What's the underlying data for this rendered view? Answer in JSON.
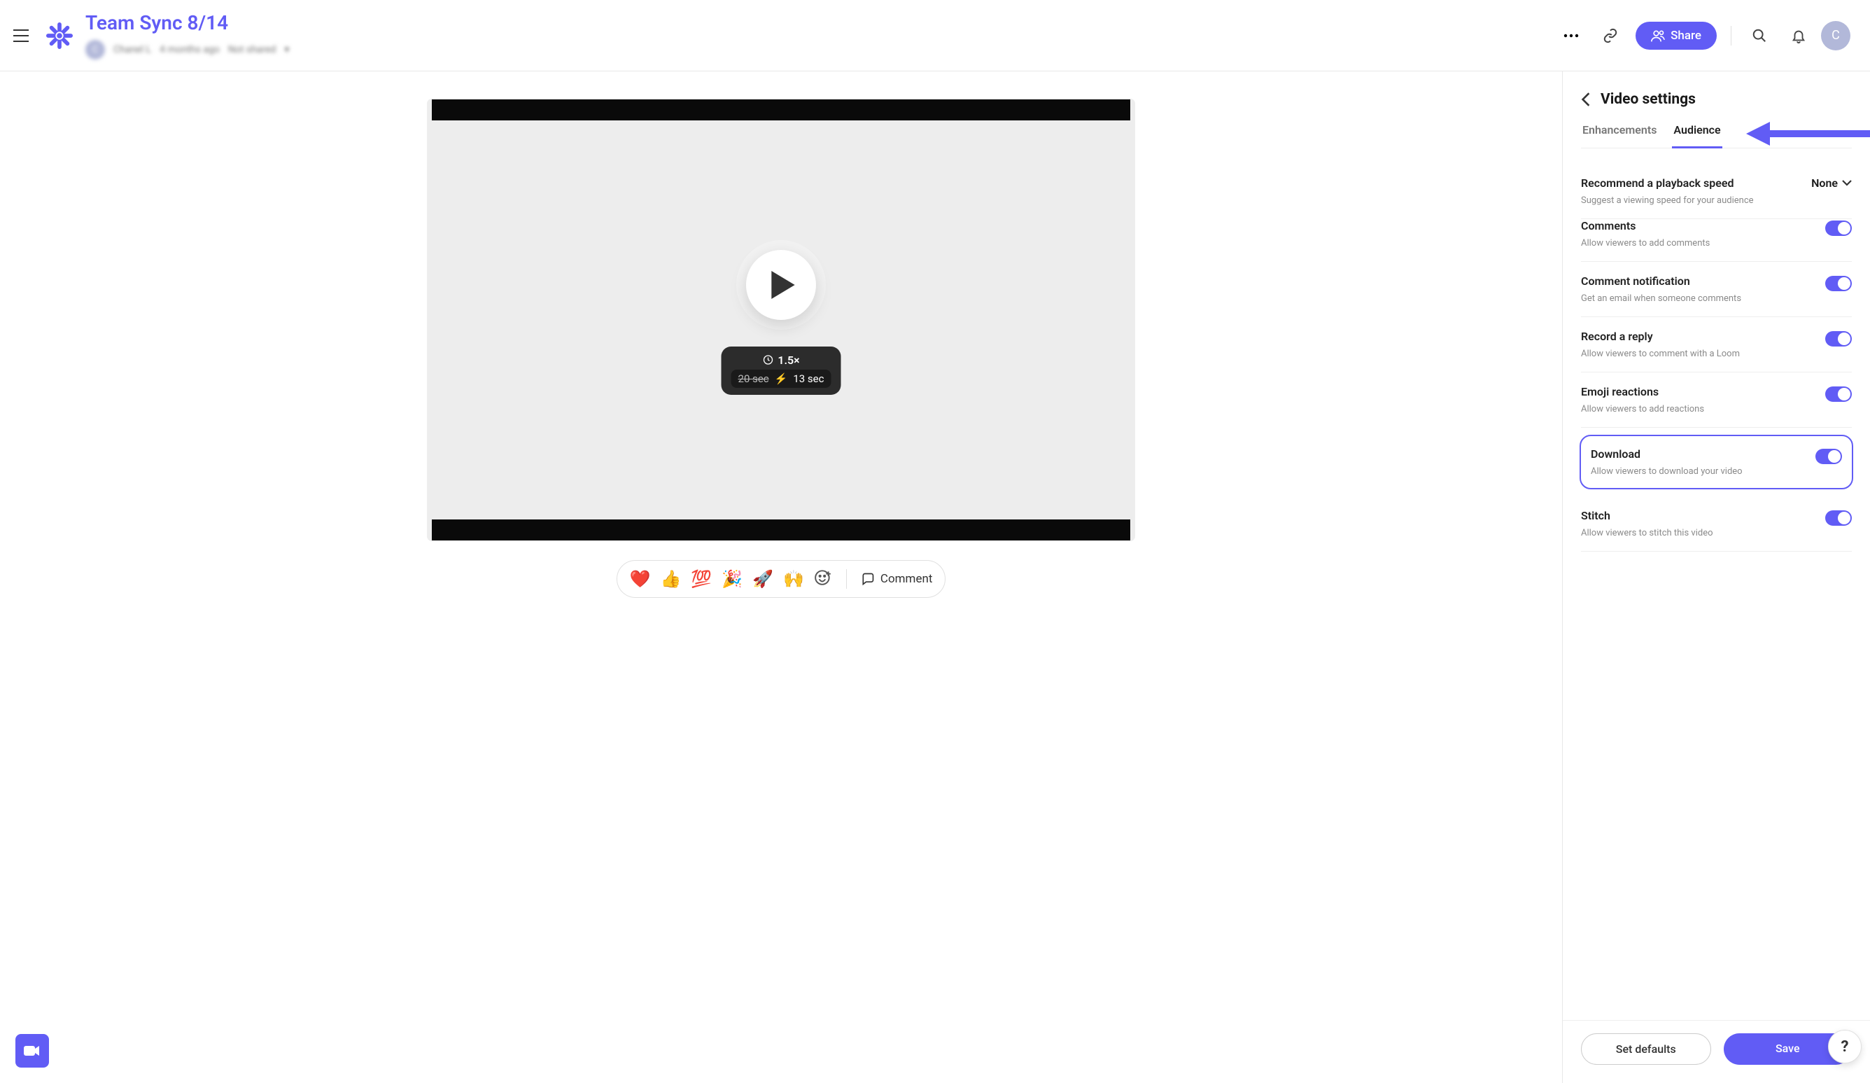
{
  "header": {
    "title": "Team Sync 8/14",
    "avatar_initial": "C",
    "meta_author": "Chanel L",
    "meta_time": "4 months ago",
    "meta_share": "Not shared"
  },
  "topbar": {
    "share_label": "Share",
    "user_initial": "C"
  },
  "video": {
    "speed_label": "1.5×",
    "duration_original": "20 sec",
    "duration_bolt": "⚡",
    "duration_new": "13 sec"
  },
  "reactions": {
    "emojis": [
      "❤️",
      "👍",
      "💯",
      "🎉",
      "🚀",
      "🙌"
    ],
    "comment_label": "Comment"
  },
  "settings_panel": {
    "title": "Video settings",
    "tabs": {
      "enhancements": "Enhancements",
      "audience": "Audience"
    },
    "playback_speed": {
      "label": "Recommend a playback speed",
      "desc": "Suggest a viewing speed for your audience",
      "value": "None"
    },
    "sections": [
      {
        "key": "comments",
        "label": "Comments",
        "desc": "Allow viewers to add comments",
        "on": true,
        "highlight": false
      },
      {
        "key": "comment_notification",
        "label": "Comment notification",
        "desc": "Get an email when someone comments",
        "on": true,
        "highlight": false
      },
      {
        "key": "record_reply",
        "label": "Record a reply",
        "desc": "Allow viewers to comment with a Loom",
        "on": true,
        "highlight": false
      },
      {
        "key": "emoji_reactions",
        "label": "Emoji reactions",
        "desc": "Allow viewers to add reactions",
        "on": true,
        "highlight": false
      },
      {
        "key": "download",
        "label": "Download",
        "desc": "Allow viewers to download your video",
        "on": true,
        "highlight": true
      },
      {
        "key": "stitch",
        "label": "Stitch",
        "desc": "Allow viewers to stitch this video",
        "on": true,
        "highlight": false
      }
    ],
    "footer": {
      "defaults": "Set defaults",
      "save": "Save"
    }
  },
  "help_label": "?"
}
